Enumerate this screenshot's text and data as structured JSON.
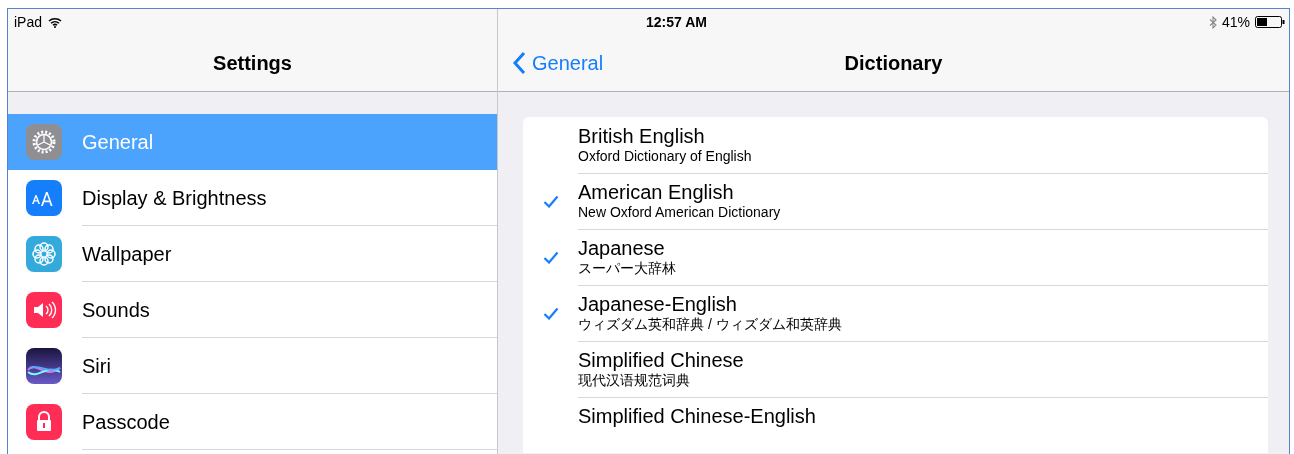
{
  "status_bar": {
    "device": "iPad",
    "time": "12:57 AM",
    "battery": "41%"
  },
  "sidebar": {
    "title": "Settings",
    "items": [
      {
        "label": "General",
        "kind": "gear",
        "selected": true
      },
      {
        "label": "Display & Brightness",
        "kind": "text",
        "selected": false
      },
      {
        "label": "Wallpaper",
        "kind": "flower",
        "selected": false
      },
      {
        "label": "Sounds",
        "kind": "speaker",
        "selected": false
      },
      {
        "label": "Siri",
        "kind": "wave",
        "selected": false
      },
      {
        "label": "Passcode",
        "kind": "lock",
        "selected": false
      }
    ]
  },
  "detail": {
    "back": "General",
    "title": "Dictionary",
    "dictionaries": [
      {
        "name": "British English",
        "subtitle": "Oxford Dictionary of English",
        "checked": false
      },
      {
        "name": "American English",
        "subtitle": "New Oxford American Dictionary",
        "checked": true
      },
      {
        "name": "Japanese",
        "subtitle": "スーパー大辞林",
        "checked": true
      },
      {
        "name": "Japanese-English",
        "subtitle": "ウィズダム英和辞典 / ウィズダム和英辞典",
        "checked": true
      },
      {
        "name": "Simplified Chinese",
        "subtitle": "现代汉语规范词典",
        "checked": false
      },
      {
        "name": "Simplified Chinese-English",
        "checked": false
      }
    ]
  }
}
